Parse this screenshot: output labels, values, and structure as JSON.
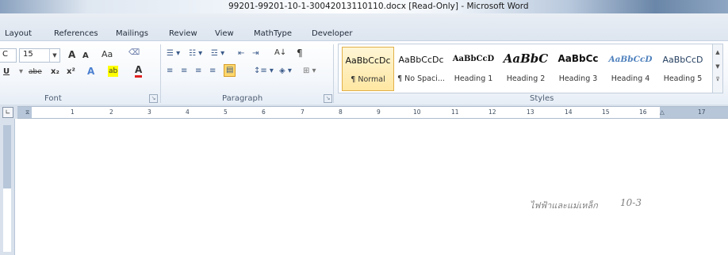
{
  "window": {
    "title": "99201-99201-10-1-30042013110110.docx [Read-Only] - Microsoft Word"
  },
  "tabs": [
    "Layout",
    "References",
    "Mailings",
    "Review",
    "View",
    "MathType",
    "Developer"
  ],
  "font_group": {
    "font_name": "C",
    "font_size": "15",
    "label": "Font",
    "buttons": {
      "grow": "A",
      "shrink": "A",
      "change_case": "Aa",
      "clear": "ᴬᴮ",
      "underline": "U",
      "strike": "abe",
      "subscript": "x₂",
      "superscript": "x²",
      "effects": "A",
      "highlight": "ab",
      "color": "A"
    }
  },
  "paragraph_group": {
    "label": "Paragraph",
    "sort": "A↓",
    "pilcrow": "¶"
  },
  "styles_group": {
    "label": "Styles",
    "items": [
      {
        "sample": "AaBbCcDc",
        "name": "¶ Normal"
      },
      {
        "sample": "AaBbCcDc",
        "name": "¶ No Spaci..."
      },
      {
        "sample": "AaBbCcD",
        "name": "Heading 1"
      },
      {
        "sample": "AaBbC",
        "name": "Heading 2"
      },
      {
        "sample": "AaBbCc",
        "name": "Heading 3"
      },
      {
        "sample": "AaBbCcD",
        "name": "Heading 4"
      },
      {
        "sample": "AaBbCcD",
        "name": "Heading 5"
      }
    ]
  },
  "ruler": {
    "ticks": [
      "1",
      "2",
      "3",
      "4",
      "5",
      "6",
      "7",
      "8",
      "9",
      "10",
      "11",
      "12",
      "13",
      "14",
      "15",
      "16",
      "17"
    ]
  },
  "document": {
    "header_text": "ไฟฟ้าและแม่เหล็ก",
    "header_number": "10-3"
  },
  "colors": {
    "ribbon_bg": "#f4f7fb",
    "selected_style": "#ffe7a2",
    "header_text": "#7f7f7f"
  }
}
